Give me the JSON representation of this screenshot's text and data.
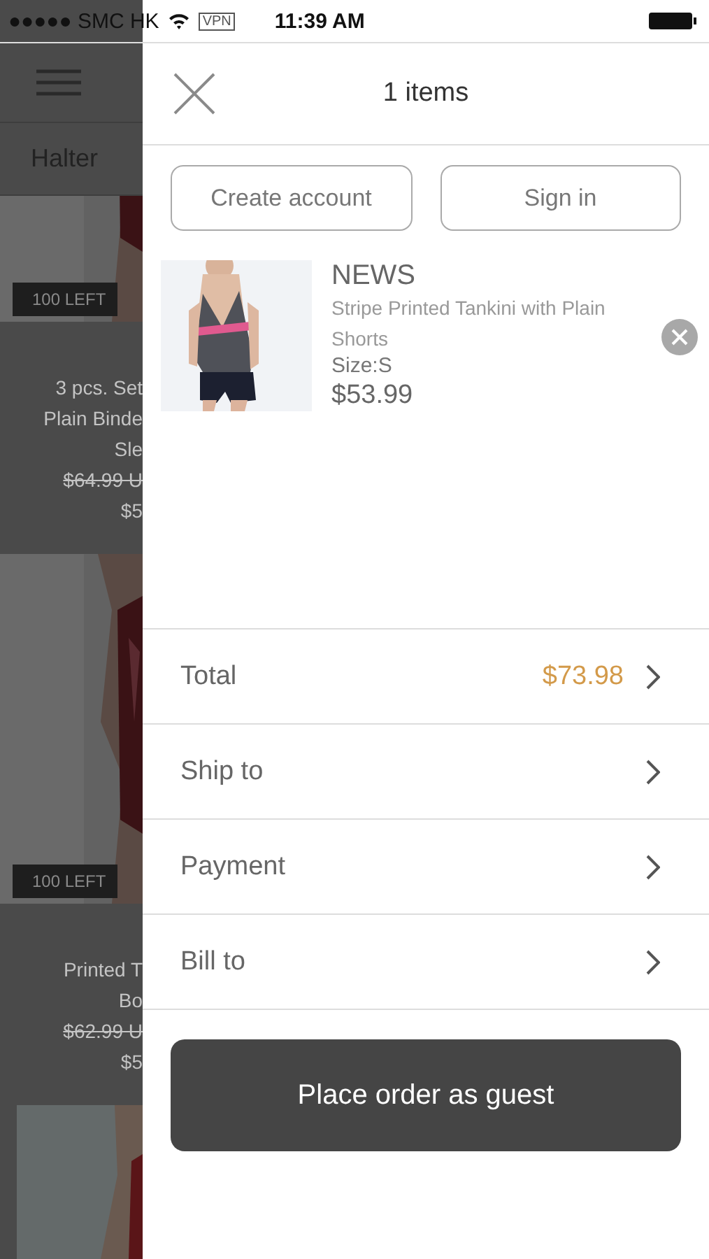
{
  "status_bar": {
    "carrier": "●●●●● SMC HK",
    "vpn": "VPN",
    "time": "11:39 AM"
  },
  "background": {
    "category": "Halter",
    "products": [
      {
        "badge": "100 LEFT",
        "title_lines": [
          "3 pcs. Set",
          "Plain Binde",
          "Sle"
        ],
        "old_price": "$64.99 U",
        "price": "$5"
      },
      {
        "badge": "100 LEFT",
        "title_lines": [
          "Printed T",
          "Bo"
        ],
        "old_price": "$62.99 U",
        "price": "$5"
      }
    ]
  },
  "cart": {
    "title": "1 items",
    "buttons": [
      "Create account",
      "Sign in"
    ],
    "items": [
      {
        "brand": "NEWS",
        "name": "Stripe Printed Tankini with Plain Shorts",
        "size": "Size:S",
        "price": "$53.99"
      }
    ],
    "rows": [
      {
        "label": "Total",
        "value": "$73.98"
      },
      {
        "label": "Ship to"
      },
      {
        "label": "Payment"
      },
      {
        "label": "Bill to"
      }
    ],
    "order_button": "Place order as guest"
  }
}
